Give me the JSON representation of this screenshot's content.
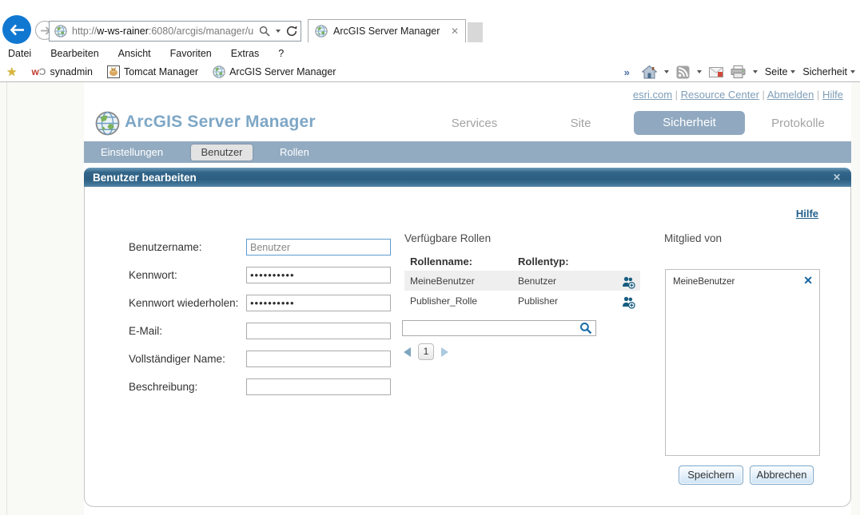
{
  "browser": {
    "url": {
      "prefix": "http://",
      "domain": "w-ws-rainer",
      "path": ":6080/arcgis/manager/u"
    },
    "tab_title": "ArcGIS Server Manager",
    "menu": [
      "Datei",
      "Bearbeiten",
      "Ansicht",
      "Favoriten",
      "Extras",
      "?"
    ],
    "favorites": [
      "synadmin",
      "Tomcat Manager",
      "ArcGIS Server Manager"
    ],
    "command_bar": {
      "overflow_chevron": "»",
      "seite": "Seite",
      "sicherheit": "Sicherheit"
    }
  },
  "page": {
    "top_links": [
      "esri.com",
      "Resource Center",
      "Abmelden",
      "Hilfe"
    ],
    "app_title": "ArcGIS Server Manager",
    "nav": [
      "Services",
      "Site",
      "Sicherheit",
      "Protokolle"
    ],
    "subnav": [
      "Einstellungen",
      "Benutzer",
      "Rollen"
    ],
    "panel": {
      "title": "Benutzer bearbeiten",
      "close_glyph": "✕",
      "help_link": "Hilfe",
      "form": {
        "fields": [
          {
            "label": "Benutzername:",
            "value": "Benutzer"
          },
          {
            "label": "Kennwort:",
            "value": "••••••••••"
          },
          {
            "label": "Kennwort wiederholen:",
            "value": "••••••••••"
          },
          {
            "label": "E-Mail:",
            "value": ""
          },
          {
            "label": "Vollständiger Name:",
            "value": ""
          },
          {
            "label": "Beschreibung:",
            "value": ""
          }
        ]
      },
      "roles": {
        "title": "Verfügbare Rollen",
        "col_name": "Rollenname:",
        "col_type": "Rollentyp:",
        "rows": [
          {
            "name": "MeineBenutzer",
            "type": "Benutzer"
          },
          {
            "name": "Publisher_Rolle",
            "type": "Publisher"
          }
        ],
        "search_value": "",
        "page_number": "1"
      },
      "membership": {
        "title": "Mitglied von",
        "items": [
          "MeineBenutzer"
        ],
        "remove_glyph": "✕"
      },
      "buttons": {
        "save": "Speichern",
        "cancel": "Abbrechen"
      }
    }
  },
  "colors": {
    "accent_blue": "#2b5e82",
    "subnav_blue": "#93abc1",
    "link_blue": "#7e9db8",
    "help_link": "#26618c",
    "icon_blue": "#185e80",
    "back_button": "#1178d1"
  }
}
